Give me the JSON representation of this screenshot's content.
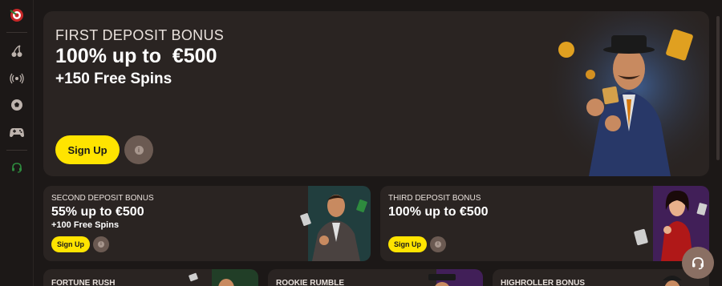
{
  "sidebar": {
    "icons": [
      "logo-icon",
      "cherries-icon",
      "broadcast-icon",
      "soccer-ball-icon",
      "gamepad-icon",
      "headset-icon"
    ]
  },
  "hero": {
    "eyebrow": "FIRST DEPOSIT BONUS",
    "headline": "100% up to  €500",
    "sub": "+150 Free Spins",
    "cta": "Sign Up",
    "info": "i"
  },
  "cards": [
    {
      "eyebrow": "SECOND DEPOSIT BONUS",
      "headline": "55% up to €500",
      "sub": "+100 Free Spins",
      "cta": "Sign Up",
      "info": "i",
      "accent": "#1e4a4a"
    },
    {
      "eyebrow": "THIRD DEPOSIT BONUS",
      "headline": "100% up to €500",
      "sub": "",
      "cta": "Sign Up",
      "info": "i",
      "accent": "#4a1e6b"
    }
  ],
  "bottom_cards": [
    {
      "title": "FORTUNE RUSH",
      "accent": "#1e4a2a"
    },
    {
      "title": "ROOKIE RUMBLE",
      "accent": "#4a1e6b"
    },
    {
      "title": "HIGHROLLER BONUS",
      "accent": "#2a2422"
    }
  ],
  "colors": {
    "background": "#1c1817",
    "panel": "#2a2422",
    "cta": "#ffe400",
    "info_button": "#6b5a52",
    "support_button": "#8a6f63"
  }
}
